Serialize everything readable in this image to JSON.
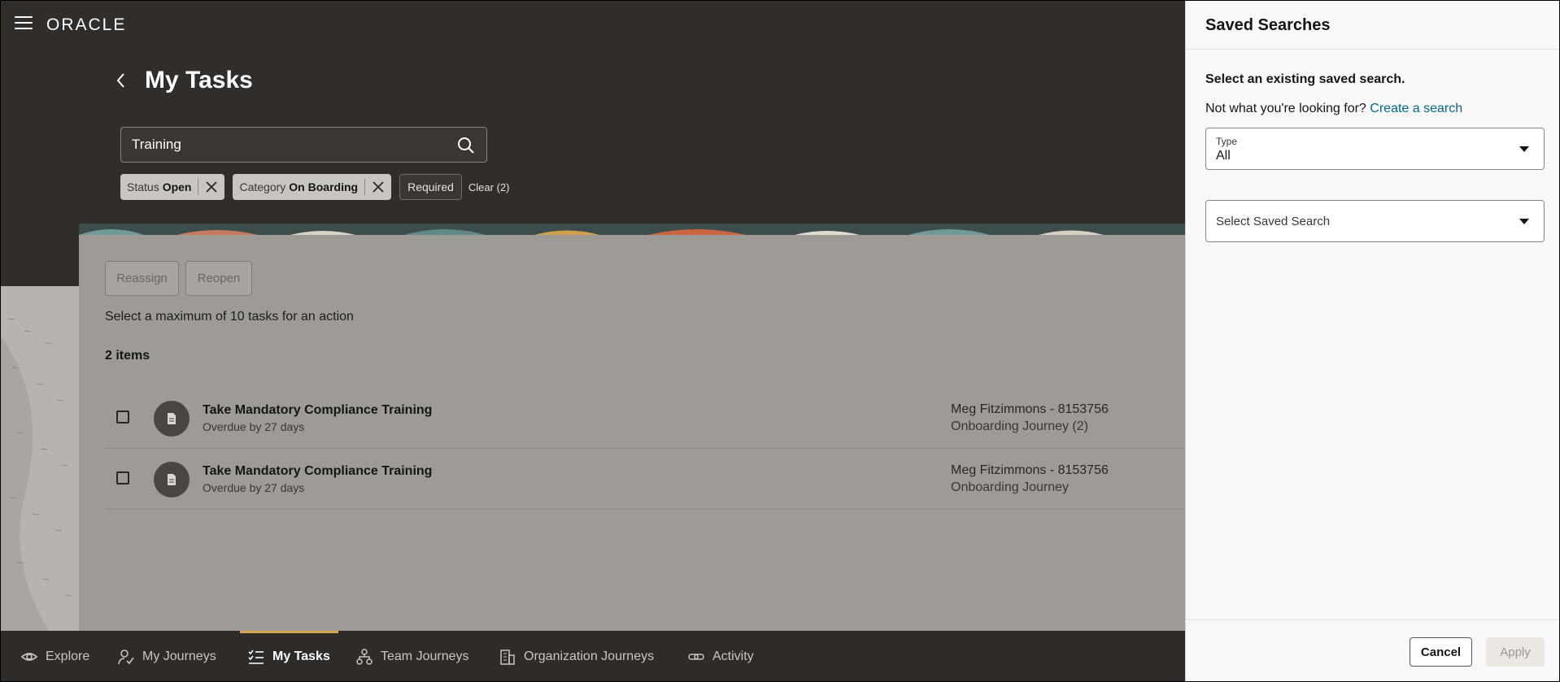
{
  "header": {
    "logo": "ORACLE"
  },
  "page": {
    "title": "My Tasks"
  },
  "search": {
    "value": "Training"
  },
  "filters": [
    {
      "label": "Status",
      "value": "Open"
    },
    {
      "label": "Category",
      "value": "On Boarding"
    }
  ],
  "filter_extra": {
    "required": "Required",
    "clear": "Clear (2)"
  },
  "actions": {
    "reassign": "Reassign",
    "reopen": "Reopen"
  },
  "info": {
    "max_text": "Select a maximum of 10 tasks for an action",
    "count": "2 items"
  },
  "tasks": [
    {
      "title": "Take Mandatory Compliance Training",
      "status": "Overdue by 27 days",
      "owner": "Meg Fitzimmons - 8153756",
      "journey": "Onboarding Journey (2)"
    },
    {
      "title": "Take Mandatory Compliance Training",
      "status": "Overdue by 27 days",
      "owner": "Meg Fitzimmons - 8153756",
      "journey": "Onboarding Journey"
    }
  ],
  "bottom_nav": [
    {
      "label": "Explore",
      "icon": "eye-icon"
    },
    {
      "label": "My Journeys",
      "icon": "person-check-icon"
    },
    {
      "label": "My Tasks",
      "icon": "task-list-icon",
      "active": true
    },
    {
      "label": "Team Journeys",
      "icon": "hierarchy-icon"
    },
    {
      "label": "Organization Journeys",
      "icon": "building-icon"
    },
    {
      "label": "Activity",
      "icon": "link-icon"
    }
  ],
  "drawer": {
    "title": "Saved Searches",
    "prompt": "Select an existing saved search.",
    "alt_text": "Not what you're looking for?",
    "create_link": "Create a search",
    "type_label": "Type",
    "type_value": "All",
    "saved_placeholder": "Select Saved Search",
    "cancel": "Cancel",
    "apply": "Apply"
  },
  "colors": {
    "accent": "#d4a54c",
    "link": "#00688c",
    "app_bg": "#312d2a"
  }
}
